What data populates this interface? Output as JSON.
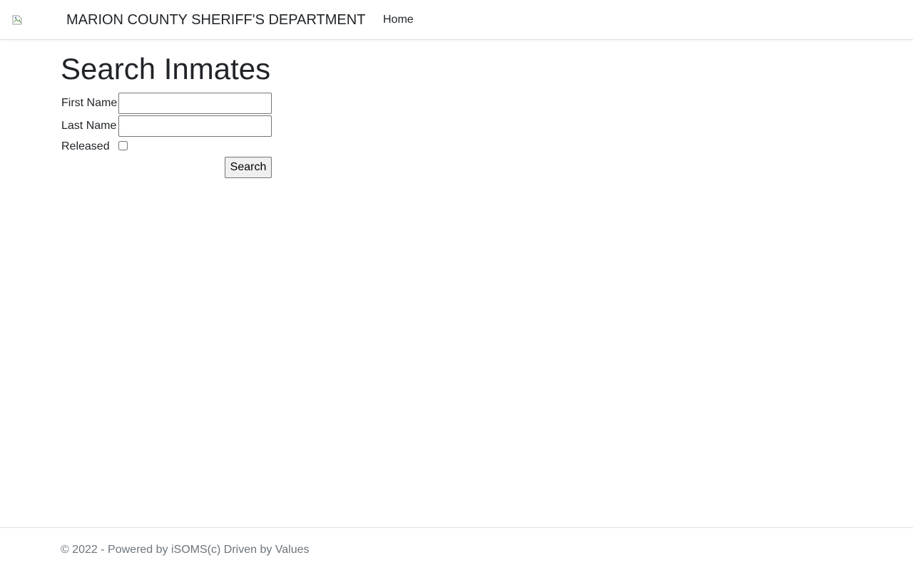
{
  "header": {
    "logo_icon": "broken-image-icon",
    "brand": "MARION COUNTY SHERIFF'S DEPARTMENT",
    "nav": {
      "home_label": "Home"
    }
  },
  "main": {
    "title": "Search Inmates",
    "form": {
      "first_name_label": "First Name",
      "first_name_value": "",
      "last_name_label": "Last Name",
      "last_name_value": "",
      "released_label": "Released",
      "released_checked": false,
      "search_label": "Search"
    }
  },
  "footer": {
    "text": "© 2022 - Powered by iSOMS(c) Driven by Values"
  },
  "colors": {
    "text": "#212529",
    "muted": "#6c757d",
    "border": "#dee2e6"
  }
}
